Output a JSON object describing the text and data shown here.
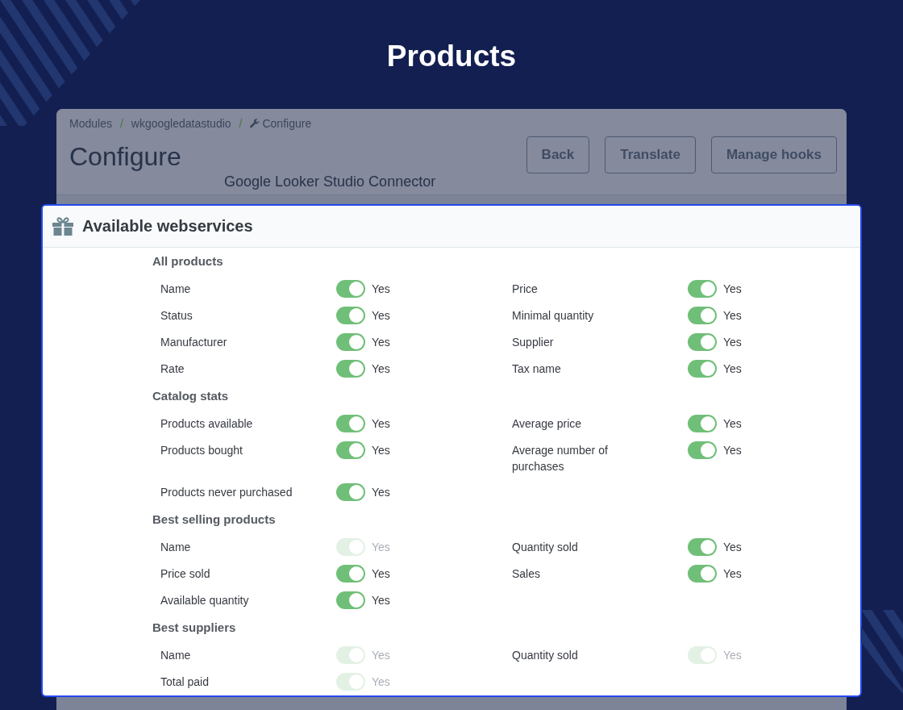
{
  "page": {
    "title": "Products"
  },
  "breadcrumb": {
    "separator": "/",
    "items": [
      "Modules",
      "wkgoogledatastudio",
      "Configure"
    ]
  },
  "header": {
    "title": "Configure",
    "subtitle": "Google Looker Studio Connector",
    "buttons": [
      "Back",
      "Translate",
      "Manage hooks"
    ]
  },
  "card": {
    "title": "Available webservices",
    "sections": [
      {
        "title": "All products",
        "items": [
          {
            "label": "Name",
            "on": true,
            "disabled": false,
            "value": "Yes"
          },
          {
            "label": "Price",
            "on": true,
            "disabled": false,
            "value": "Yes"
          },
          {
            "label": "Status",
            "on": true,
            "disabled": false,
            "value": "Yes"
          },
          {
            "label": "Minimal quantity",
            "on": true,
            "disabled": false,
            "value": "Yes"
          },
          {
            "label": "Manufacturer",
            "on": true,
            "disabled": false,
            "value": "Yes"
          },
          {
            "label": "Supplier",
            "on": true,
            "disabled": false,
            "value": "Yes"
          },
          {
            "label": "Rate",
            "on": true,
            "disabled": false,
            "value": "Yes"
          },
          {
            "label": "Tax name",
            "on": true,
            "disabled": false,
            "value": "Yes"
          }
        ]
      },
      {
        "title": "Catalog stats",
        "items": [
          {
            "label": "Products available",
            "on": true,
            "disabled": false,
            "value": "Yes"
          },
          {
            "label": "Average price",
            "on": true,
            "disabled": false,
            "value": "Yes"
          },
          {
            "label": "Products bought",
            "on": true,
            "disabled": false,
            "value": "Yes"
          },
          {
            "label": "Average number of purchases",
            "on": true,
            "disabled": false,
            "value": "Yes"
          },
          {
            "label": "Products never purchased",
            "on": true,
            "disabled": false,
            "value": "Yes"
          }
        ]
      },
      {
        "title": "Best selling products",
        "items": [
          {
            "label": "Name",
            "on": true,
            "disabled": true,
            "value": "Yes"
          },
          {
            "label": "Quantity sold",
            "on": true,
            "disabled": false,
            "value": "Yes"
          },
          {
            "label": "Price sold",
            "on": true,
            "disabled": false,
            "value": "Yes"
          },
          {
            "label": "Sales",
            "on": true,
            "disabled": false,
            "value": "Yes"
          },
          {
            "label": "Available quantity",
            "on": true,
            "disabled": false,
            "value": "Yes"
          }
        ]
      },
      {
        "title": "Best suppliers",
        "items": [
          {
            "label": "Name",
            "on": true,
            "disabled": true,
            "value": "Yes"
          },
          {
            "label": "Quantity sold",
            "on": true,
            "disabled": true,
            "value": "Yes"
          },
          {
            "label": "Total paid",
            "on": true,
            "disabled": true,
            "value": "Yes"
          }
        ]
      }
    ]
  }
}
